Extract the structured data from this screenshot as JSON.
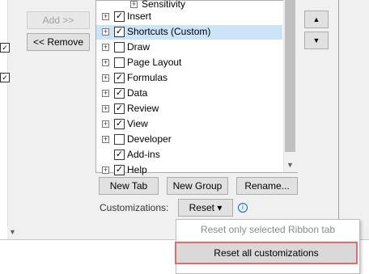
{
  "left_panel": {
    "check_marks": [
      "✓",
      "✓"
    ],
    "scroll_down_glyph": "▼"
  },
  "transfer_buttons": {
    "add_label": "Add >>",
    "remove_label": "<< Remove"
  },
  "ribbon_tree": {
    "items": [
      {
        "label": "Sensitivity",
        "expand": "+",
        "checked": false,
        "has_checkbox": false
      },
      {
        "label": "Insert",
        "expand": "+",
        "checked": true,
        "has_checkbox": true
      },
      {
        "label": "Shortcuts (Custom)",
        "expand": "+",
        "checked": true,
        "has_checkbox": true,
        "selected": true
      },
      {
        "label": "Draw",
        "expand": "+",
        "checked": false,
        "has_checkbox": true
      },
      {
        "label": "Page Layout",
        "expand": "+",
        "checked": false,
        "has_checkbox": true
      },
      {
        "label": "Formulas",
        "expand": "+",
        "checked": true,
        "has_checkbox": true
      },
      {
        "label": "Data",
        "expand": "+",
        "checked": true,
        "has_checkbox": true
      },
      {
        "label": "Review",
        "expand": "+",
        "checked": true,
        "has_checkbox": true
      },
      {
        "label": "View",
        "expand": "+",
        "checked": true,
        "has_checkbox": true
      },
      {
        "label": "Developer",
        "expand": "+",
        "checked": false,
        "has_checkbox": true
      },
      {
        "label": "Add-ins",
        "expand": "",
        "checked": true,
        "has_checkbox": true
      },
      {
        "label": "Help",
        "expand": "+",
        "checked": true,
        "has_checkbox": true
      }
    ],
    "check_glyph": "✓",
    "scroll_down_glyph": "▼"
  },
  "order_buttons": {
    "up_glyph": "▲",
    "down_glyph": "▼"
  },
  "bottom_buttons": {
    "new_tab_label": "New Tab",
    "new_group_label": "New Group",
    "rename_label": "Rename..."
  },
  "customizations": {
    "label": "Customizations:",
    "reset_label": "Reset ▾",
    "info_glyph": "i"
  },
  "reset_menu": {
    "item_selected_tab": "Reset only selected Ribbon tab",
    "item_all": "Reset all customizations"
  }
}
